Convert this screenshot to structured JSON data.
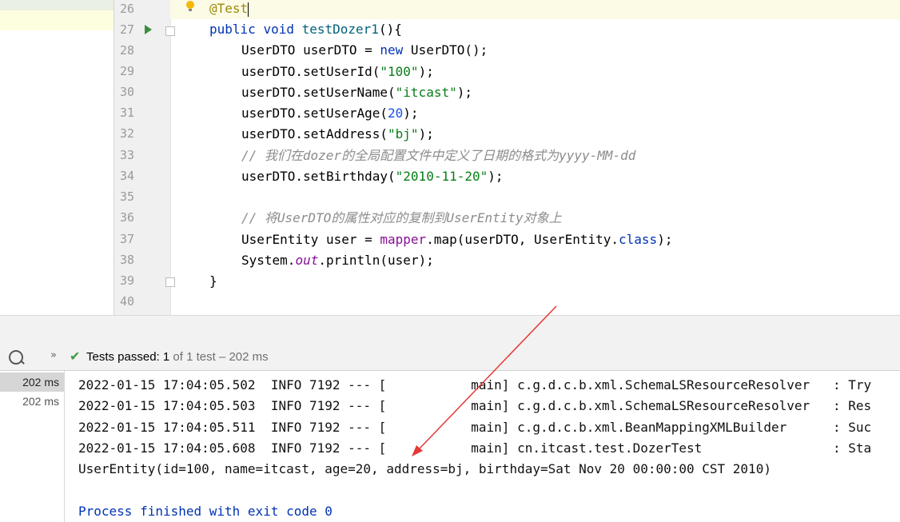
{
  "editor": {
    "line_numbers": [
      "26",
      "27",
      "28",
      "29",
      "30",
      "31",
      "32",
      "33",
      "34",
      "35",
      "36",
      "37",
      "38",
      "39",
      "40"
    ],
    "lines": {
      "l26": {
        "ann": "@Test"
      },
      "l27": {
        "kw1": "public",
        "kw2": "void",
        "fn": "testDozer1",
        "rest": "(){"
      },
      "l28": {
        "a": "UserDTO userDTO = ",
        "kw": "new",
        "b": " UserDTO();"
      },
      "l29": {
        "a": "userDTO.setUserId(",
        "str": "\"100\"",
        "b": ");"
      },
      "l30": {
        "a": "userDTO.setUserName(",
        "str": "\"itcast\"",
        "b": ");"
      },
      "l31": {
        "a": "userDTO.setUserAge(",
        "num": "20",
        "b": ");"
      },
      "l32": {
        "a": "userDTO.setAddress(",
        "str": "\"bj\"",
        "b": ");"
      },
      "l33": {
        "cmt": "// 我们在dozer的全局配置文件中定义了日期的格式为yyyy-MM-dd"
      },
      "l34": {
        "a": "userDTO.setBirthday(",
        "str": "\"2010-11-20\"",
        "b": ");"
      },
      "l36": {
        "cmt": "// 将UserDTO的属性对应的复制到UserEntity对象上"
      },
      "l37": {
        "a": "UserEntity user = ",
        "fld": "mapper",
        "b": ".map(userDTO, UserEntity.",
        "kw": "class",
        "c": ");"
      },
      "l38": {
        "a": "System.",
        "sfld": "out",
        "b": ".println(user);"
      },
      "l39": {
        "a": "}"
      }
    }
  },
  "test_panel": {
    "expand_glyph": "»",
    "status_label": "Tests passed:",
    "status_count": "1",
    "status_rest": "of 1 test – 202 ms",
    "tree_rows": [
      "202 ms",
      "202 ms"
    ]
  },
  "console": {
    "lines": [
      "2022-01-15 17:04:05.502  INFO 7192 --- [           main] c.g.d.c.b.xml.SchemaLSResourceResolver   : Try",
      "2022-01-15 17:04:05.503  INFO 7192 --- [           main] c.g.d.c.b.xml.SchemaLSResourceResolver   : Res",
      "2022-01-15 17:04:05.511  INFO 7192 --- [           main] c.g.d.c.b.xml.BeanMappingXMLBuilder      : Suc",
      "2022-01-15 17:04:05.608  INFO 7192 --- [           main] cn.itcast.test.DozerTest                 : Sta",
      "UserEntity(id=100, name=itcast, age=20, address=bj, birthday=Sat Nov 20 00:00:00 CST 2010)",
      "",
      "Process finished with exit code 0"
    ]
  },
  "colors": {
    "arrow": "#e53935",
    "keyword": "#0033b3",
    "string": "#067d17",
    "pass": "#3c9a3c"
  }
}
